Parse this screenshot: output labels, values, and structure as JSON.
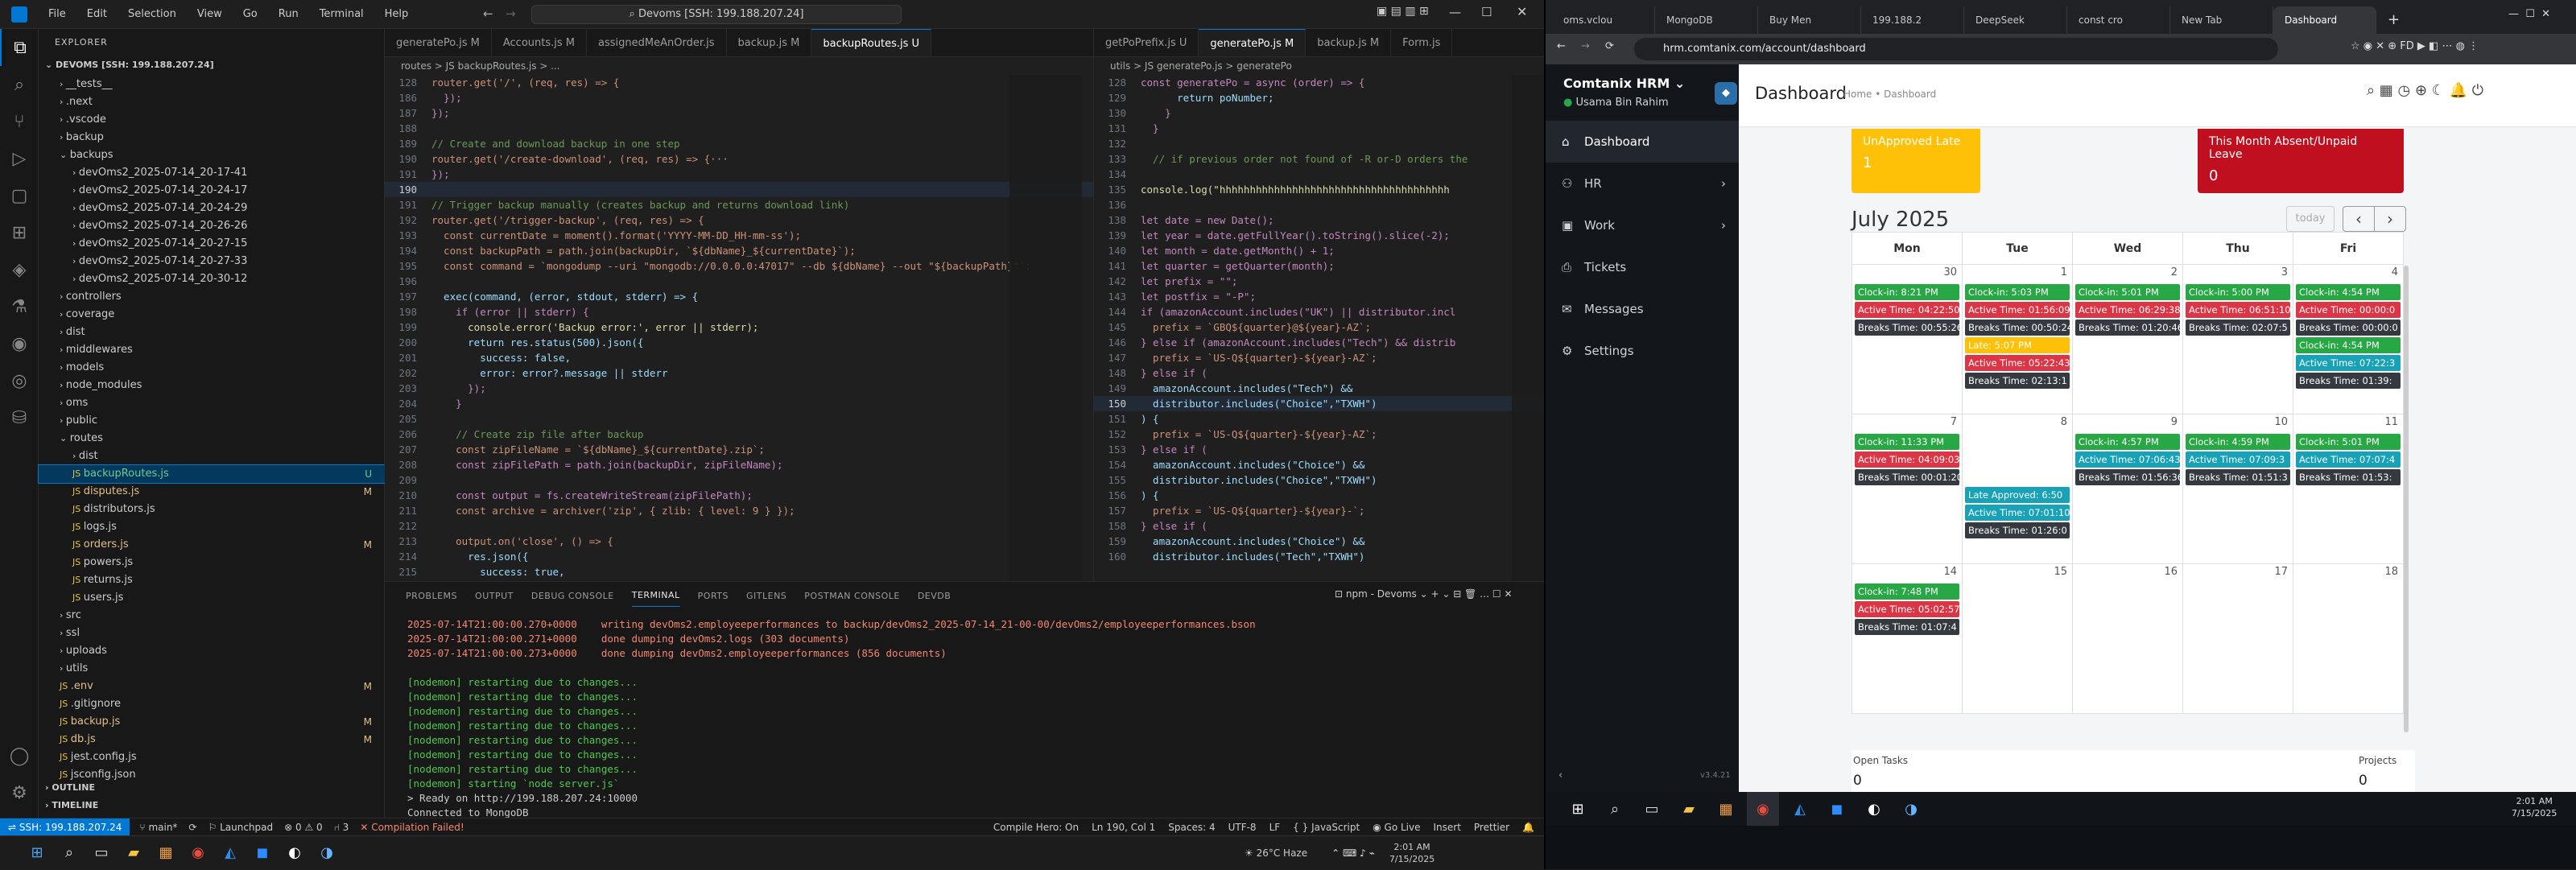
{
  "vscode": {
    "menu": [
      "File",
      "Edit",
      "Selection",
      "View",
      "Go",
      "Run",
      "Terminal",
      "Help"
    ],
    "search": "Devoms [SSH: 199.188.207.24]",
    "explorer_title": "EXPLORER",
    "workspace": "DEVOMS [SSH: 199.188.207.24]",
    "tree": [
      {
        "label": "__tests__",
        "depth": 1,
        "folder": true,
        "status": ""
      },
      {
        "label": ".next",
        "depth": 1,
        "folder": true,
        "status": ""
      },
      {
        "label": ".vscode",
        "depth": 1,
        "folder": true,
        "status": ""
      },
      {
        "label": "backup",
        "depth": 1,
        "folder": true,
        "status": ""
      },
      {
        "label": "backups",
        "depth": 1,
        "folder": true,
        "open": true,
        "status": ""
      },
      {
        "label": "devOms2_2025-07-14_20-17-41",
        "depth": 2,
        "folder": true,
        "status": ""
      },
      {
        "label": "devOms2_2025-07-14_20-24-17",
        "depth": 2,
        "folder": true,
        "status": ""
      },
      {
        "label": "devOms2_2025-07-14_20-24-29",
        "depth": 2,
        "folder": true,
        "status": ""
      },
      {
        "label": "devOms2_2025-07-14_20-26-26",
        "depth": 2,
        "folder": true,
        "status": ""
      },
      {
        "label": "devOms2_2025-07-14_20-27-15",
        "depth": 2,
        "folder": true,
        "status": ""
      },
      {
        "label": "devOms2_2025-07-14_20-27-33",
        "depth": 2,
        "folder": true,
        "status": ""
      },
      {
        "label": "devOms2_2025-07-14_20-30-12",
        "depth": 2,
        "folder": true,
        "status": ""
      },
      {
        "label": "controllers",
        "depth": 1,
        "folder": true,
        "status": ""
      },
      {
        "label": "coverage",
        "depth": 1,
        "folder": true,
        "status": ""
      },
      {
        "label": "dist",
        "depth": 1,
        "folder": true,
        "status": ""
      },
      {
        "label": "middlewares",
        "depth": 1,
        "folder": true,
        "status": ""
      },
      {
        "label": "models",
        "depth": 1,
        "folder": true,
        "status": ""
      },
      {
        "label": "node_modules",
        "depth": 1,
        "folder": true,
        "status": ""
      },
      {
        "label": "oms",
        "depth": 1,
        "folder": true,
        "status": ""
      },
      {
        "label": "public",
        "depth": 1,
        "folder": true,
        "status": ""
      },
      {
        "label": "routes",
        "depth": 1,
        "folder": true,
        "open": true,
        "status": ""
      },
      {
        "label": "dist",
        "depth": 2,
        "folder": true,
        "status": ""
      },
      {
        "label": "backupRoutes.js",
        "depth": 2,
        "folder": false,
        "status": "U",
        "selected": true
      },
      {
        "label": "disputes.js",
        "depth": 2,
        "folder": false,
        "status": "M"
      },
      {
        "label": "distributors.js",
        "depth": 2,
        "folder": false,
        "status": ""
      },
      {
        "label": "logs.js",
        "depth": 2,
        "folder": false,
        "status": ""
      },
      {
        "label": "orders.js",
        "depth": 2,
        "folder": false,
        "status": "M"
      },
      {
        "label": "powers.js",
        "depth": 2,
        "folder": false,
        "status": ""
      },
      {
        "label": "returns.js",
        "depth": 2,
        "folder": false,
        "status": ""
      },
      {
        "label": "users.js",
        "depth": 2,
        "folder": false,
        "status": ""
      },
      {
        "label": "src",
        "depth": 1,
        "folder": true,
        "status": ""
      },
      {
        "label": "ssl",
        "depth": 1,
        "folder": true,
        "status": ""
      },
      {
        "label": "uploads",
        "depth": 1,
        "folder": true,
        "status": ""
      },
      {
        "label": "utils",
        "depth": 1,
        "folder": true,
        "status": ""
      },
      {
        "label": ".env",
        "depth": 1,
        "folder": false,
        "status": "M"
      },
      {
        "label": ".gitignore",
        "depth": 1,
        "folder": false,
        "status": ""
      },
      {
        "label": "backup.js",
        "depth": 1,
        "folder": false,
        "status": "M"
      },
      {
        "label": "db.js",
        "depth": 1,
        "folder": false,
        "status": "M"
      },
      {
        "label": "jest.config.js",
        "depth": 1,
        "folder": false,
        "status": ""
      },
      {
        "label": "jsconfig.json",
        "depth": 1,
        "folder": false,
        "status": ""
      }
    ],
    "outline": "OUTLINE",
    "timeline": "TIMELINE",
    "tabs1": [
      "generatePo.js M",
      "Accounts.js M",
      "assignedMeAnOrder.js",
      "backup.js M",
      "backupRoutes.js U"
    ],
    "crumbs1": "routes > JS backupRoutes.js > ...",
    "code1": [
      {
        "n": "128",
        "t": "router.get('/', (req, res) => {"
      },
      {
        "n": "186",
        "t": "  });"
      },
      {
        "n": "187",
        "t": "});"
      },
      {
        "n": "188",
        "t": ""
      },
      {
        "n": "189",
        "t": "// Create and download backup in one step"
      },
      {
        "n": "190",
        "t": "router.get('/create-download', (req, res) => {···"
      },
      {
        "n": "191",
        "t": "});"
      },
      {
        "n": "190",
        "t": "",
        "cur": true
      },
      {
        "n": "191",
        "t": "// Trigger backup manually (creates backup and returns download link)"
      },
      {
        "n": "192",
        "t": "router.get('/trigger-backup', (req, res) => {"
      },
      {
        "n": "193",
        "t": "  const currentDate = moment().format('YYYY-MM-DD_HH-mm-ss');"
      },
      {
        "n": "194",
        "t": "  const backupPath = path.join(backupDir, `${dbName}_${currentDate}`);"
      },
      {
        "n": "195",
        "t": "  const command = `mongodump --uri \"mongodb://0.0.0.0:47017\" --db ${dbName} --out \"${backupPath}\"`;"
      },
      {
        "n": "196",
        "t": ""
      },
      {
        "n": "197",
        "t": "  exec(command, (error, stdout, stderr) => {"
      },
      {
        "n": "198",
        "t": "    if (error || stderr) {"
      },
      {
        "n": "199",
        "t": "      console.error('Backup error:', error || stderr);"
      },
      {
        "n": "200",
        "t": "      return res.status(500).json({"
      },
      {
        "n": "201",
        "t": "        success: false,"
      },
      {
        "n": "202",
        "t": "        error: error?.message || stderr"
      },
      {
        "n": "203",
        "t": "      });"
      },
      {
        "n": "204",
        "t": "    }"
      },
      {
        "n": "205",
        "t": ""
      },
      {
        "n": "206",
        "t": "    // Create zip file after backup"
      },
      {
        "n": "207",
        "t": "    const zipFileName = `${dbName}_${currentDate}.zip`;"
      },
      {
        "n": "208",
        "t": "    const zipFilePath = path.join(backupDir, zipFileName);"
      },
      {
        "n": "209",
        "t": ""
      },
      {
        "n": "210",
        "t": "    const output = fs.createWriteStream(zipFilePath);"
      },
      {
        "n": "211",
        "t": "    const archive = archiver('zip', { zlib: { level: 9 } });"
      },
      {
        "n": "212",
        "t": ""
      },
      {
        "n": "213",
        "t": "    output.on('close', () => {"
      },
      {
        "n": "214",
        "t": "      res.json({"
      },
      {
        "n": "215",
        "t": "        success: true,"
      }
    ],
    "tabs2": [
      "getPoPrefix.js U",
      "generatePo.js M",
      "backup.js M",
      "Form.js"
    ],
    "crumbs2": "utils > JS generatePo.js > generatePo",
    "code2": [
      {
        "n": "128",
        "t": "const generatePo = async (order) => {"
      },
      {
        "n": "129",
        "t": "      return poNumber;"
      },
      {
        "n": "130",
        "t": "    }"
      },
      {
        "n": "131",
        "t": "  }"
      },
      {
        "n": "132",
        "t": ""
      },
      {
        "n": "133",
        "t": "  // if previous order not found of -R or-D orders the"
      },
      {
        "n": "134",
        "t": ""
      },
      {
        "n": "135",
        "t": "console.log(\"hhhhhhhhhhhhhhhhhhhhhhhhhhhhhhhhhhhhhh"
      },
      {
        "n": "136",
        "t": ""
      },
      {
        "n": "138",
        "t": "let date = new Date();"
      },
      {
        "n": "139",
        "t": "let year = date.getFullYear().toString().slice(-2);"
      },
      {
        "n": "140",
        "t": "let month = date.getMonth() + 1;"
      },
      {
        "n": "141",
        "t": "let quarter = getQuarter(month);"
      },
      {
        "n": "142",
        "t": "let prefix = \"\";"
      },
      {
        "n": "143",
        "t": "let postfix = \"-P\";"
      },
      {
        "n": "144",
        "t": "if (amazonAccount.includes(\"UK\") || distributor.incl"
      },
      {
        "n": "145",
        "t": "  prefix = `GBQ${quarter}@${year}-AZ`;"
      },
      {
        "n": "146",
        "t": "} else if (amazonAccount.includes(\"Tech\") && distrib"
      },
      {
        "n": "147",
        "t": "  prefix = `US-Q${quarter}-${year}-AZ`;"
      },
      {
        "n": "148",
        "t": "} else if ("
      },
      {
        "n": "149",
        "t": "  amazonAccount.includes(\"Tech\") &&"
      },
      {
        "n": "150",
        "t": "  distributor.includes(\"Choice\",\"TXWH\")",
        "cur": true
      },
      {
        "n": "151",
        "t": ") {"
      },
      {
        "n": "152",
        "t": "  prefix = `US-Q${quarter}-${year}-AZ`;"
      },
      {
        "n": "153",
        "t": "} else if ("
      },
      {
        "n": "154",
        "t": "  amazonAccount.includes(\"Choice\") &&"
      },
      {
        "n": "155",
        "t": "  distributor.includes(\"Choice\",\"TXWH\")"
      },
      {
        "n": "156",
        "t": ") {"
      },
      {
        "n": "157",
        "t": "  prefix = `US-Q${quarter}-${year}-`;"
      },
      {
        "n": "158",
        "t": "} else if ("
      },
      {
        "n": "159",
        "t": "  amazonAccount.includes(\"Choice\") &&"
      },
      {
        "n": "160",
        "t": "  distributor.includes(\"Tech\",\"TXWH\")"
      }
    ],
    "panel_tabs": [
      "PROBLEMS",
      "OUTPUT",
      "DEBUG CONSOLE",
      "TERMINAL",
      "PORTS",
      "GITLENS",
      "POSTMAN CONSOLE",
      "DEVDB"
    ],
    "terminal_name": "npm - Devoms",
    "terminal": [
      {
        "t": "2025-07-14T21:00:00.270+0000    writing devOms2.employeeperformances to backup/devOms2_2025-07-14_21-00-00/devOms2/employeeperformances.bson",
        "c": "#f48771"
      },
      {
        "t": "2025-07-14T21:00:00.271+0000    done dumping devOms2.logs (303 documents)",
        "c": "#f48771"
      },
      {
        "t": "2025-07-14T21:00:00.273+0000    done dumping devOms2.employeeperformances (856 documents)",
        "c": "#f48771"
      },
      {
        "t": "",
        "c": "#ccc"
      },
      {
        "t": "[nodemon] restarting due to changes...",
        "c": "#4ec94e"
      },
      {
        "t": "[nodemon] restarting due to changes...",
        "c": "#4ec94e"
      },
      {
        "t": "[nodemon] restarting due to changes...",
        "c": "#4ec94e"
      },
      {
        "t": "[nodemon] restarting due to changes...",
        "c": "#4ec94e"
      },
      {
        "t": "[nodemon] restarting due to changes...",
        "c": "#4ec94e"
      },
      {
        "t": "[nodemon] restarting due to changes...",
        "c": "#4ec94e"
      },
      {
        "t": "[nodemon] restarting due to changes...",
        "c": "#4ec94e"
      },
      {
        "t": "[nodemon] starting `node server.js`",
        "c": "#4ec94e"
      },
      {
        "t": "> Ready on http://199.188.207.24:10000",
        "c": "#ccc"
      },
      {
        "t": "Connected to MongoDB",
        "c": "#ccc"
      }
    ],
    "status": {
      "remote": "SSH: 199.188.207.24",
      "branch": "main*",
      "launchpad": "Launchpad",
      "errors": "0",
      "warnings": "0",
      "ports": "3",
      "compile": "Compilation Failed!",
      "hero": "Compile Hero: On",
      "pos": "Ln 190, Col 1",
      "spaces": "Spaces: 4",
      "enc": "UTF-8",
      "eol": "LF",
      "lang": "JavaScript",
      "golive": "Go Live",
      "insert": "Insert",
      "prettier": "Prettier"
    },
    "weather": "26°C  Haze",
    "clock_time": "2:01 AM",
    "clock_date": "7/15/2025"
  },
  "browser": {
    "tabs": [
      "oms.vclou",
      "MongoDB",
      "Buy Men",
      "199.188.2",
      "DeepSeek",
      "const cro",
      "New Tab",
      "Dashboard"
    ],
    "url": "hrm.comtanix.com/account/dashboard"
  },
  "hrm": {
    "company": "Comtanix HRM",
    "user": "Usama Bin Rahim",
    "nav": [
      "Dashboard",
      "HR",
      "Work",
      "Tickets",
      "Messages",
      "Settings"
    ],
    "page_title": "Dashboard",
    "crumb": "Home • Dashboard",
    "card1_title": "UnApproved Late",
    "card1_value": "1",
    "card2_title": "This Month Absent/Unpaid Leave",
    "card2_value": "0",
    "month": "July 2025",
    "today_btn": "today",
    "prev": "‹",
    "next": "›",
    "weekdays": [
      "Mon",
      "Tue",
      "Wed",
      "Thu",
      "Fri"
    ],
    "weeks": [
      {
        "days": [
          {
            "d": "30",
            "ev": [
              {
                "t": "Clock-in: 8:21 PM",
                "c": "#28a745"
              },
              {
                "t": "Active Time: 04:22:50",
                "c": "#dc3545"
              },
              {
                "t": "Breaks Time: 00:55:26",
                "c": "#343a40"
              }
            ]
          },
          {
            "d": "1",
            "ev": [
              {
                "t": "Clock-in: 5:03 PM",
                "c": "#28a745"
              },
              {
                "t": "Active Time: 01:56:09",
                "c": "#dc3545"
              },
              {
                "t": "Breaks Time: 00:50:24",
                "c": "#343a40"
              },
              {
                "t": "Late: 5:07 PM",
                "c": "#ffc107"
              },
              {
                "t": "Active Time: 05:22:43",
                "c": "#dc3545"
              },
              {
                "t": "Breaks Time: 02:13:1",
                "c": "#343a40"
              }
            ]
          },
          {
            "d": "2",
            "ev": [
              {
                "t": "Clock-in: 5:01 PM",
                "c": "#28a745"
              },
              {
                "t": "Active Time: 06:29:38",
                "c": "#dc3545"
              },
              {
                "t": "Breaks Time: 01:20:46",
                "c": "#343a40"
              }
            ]
          },
          {
            "d": "3",
            "ev": [
              {
                "t": "Clock-in: 5:00 PM",
                "c": "#28a745"
              },
              {
                "t": "Active Time: 06:51:10",
                "c": "#dc3545"
              },
              {
                "t": "Breaks Time: 02:07:5",
                "c": "#343a40"
              }
            ]
          },
          {
            "d": "4",
            "ev": [
              {
                "t": "Clock-in: 4:54 PM",
                "c": "#28a745"
              },
              {
                "t": "Active Time: 00:00:0",
                "c": "#dc3545"
              },
              {
                "t": "Breaks Time: 00:00:0",
                "c": "#343a40"
              },
              {
                "t": "Clock-in: 4:54 PM",
                "c": "#28a745"
              },
              {
                "t": "Active Time: 07:22:3",
                "c": "#17a2b8"
              },
              {
                "t": "Breaks Time: 01:39:",
                "c": "#343a40"
              }
            ]
          }
        ]
      },
      {
        "days": [
          {
            "d": "7",
            "ev": [
              {
                "t": "Clock-in: 11:33 PM",
                "c": "#28a745"
              },
              {
                "t": "Active Time: 04:09:03",
                "c": "#dc3545"
              },
              {
                "t": "Breaks Time: 00:01:20",
                "c": "#343a40"
              }
            ]
          },
          {
            "d": "8",
            "ev": [
              {
                "t": "",
                "c": "transparent"
              },
              {
                "t": "",
                "c": "transparent"
              },
              {
                "t": "",
                "c": "transparent"
              },
              {
                "t": "Late Approved: 6:50",
                "c": "#17a2b8"
              },
              {
                "t": "Active Time: 07:01:10",
                "c": "#17a2b8"
              },
              {
                "t": "Breaks Time: 01:26:0",
                "c": "#343a40"
              }
            ]
          },
          {
            "d": "9",
            "ev": [
              {
                "t": "Clock-in: 4:57 PM",
                "c": "#28a745"
              },
              {
                "t": "Active Time: 07:06:43",
                "c": "#17a2b8"
              },
              {
                "t": "Breaks Time: 01:56:36",
                "c": "#343a40"
              }
            ]
          },
          {
            "d": "10",
            "ev": [
              {
                "t": "Clock-in: 4:59 PM",
                "c": "#28a745"
              },
              {
                "t": "Active Time: 07:09:3",
                "c": "#17a2b8"
              },
              {
                "t": "Breaks Time: 01:51:3",
                "c": "#343a40"
              }
            ]
          },
          {
            "d": "11",
            "ev": [
              {
                "t": "Clock-in: 5:01 PM",
                "c": "#28a745"
              },
              {
                "t": "Active Time: 07:07:4",
                "c": "#17a2b8"
              },
              {
                "t": "Breaks Time: 01:53:",
                "c": "#343a40"
              }
            ]
          }
        ]
      },
      {
        "days": [
          {
            "d": "14",
            "ev": [
              {
                "t": "Clock-in: 7:48 PM",
                "c": "#28a745"
              },
              {
                "t": "Active Time: 05:02:57",
                "c": "#dc3545"
              },
              {
                "t": "Breaks Time: 01:07:4",
                "c": "#343a40"
              }
            ]
          },
          {
            "d": "15",
            "ev": []
          },
          {
            "d": "16",
            "ev": []
          },
          {
            "d": "17",
            "ev": []
          },
          {
            "d": "18",
            "ev": []
          }
        ]
      }
    ],
    "open_tasks_label": "Open Tasks",
    "open_tasks_value": "0",
    "projects_label": "Projects",
    "projects_value": "0",
    "version": "v3.4.21"
  },
  "taskbar_right": {
    "time": "2:01 AM",
    "date": "7/15/2025"
  }
}
